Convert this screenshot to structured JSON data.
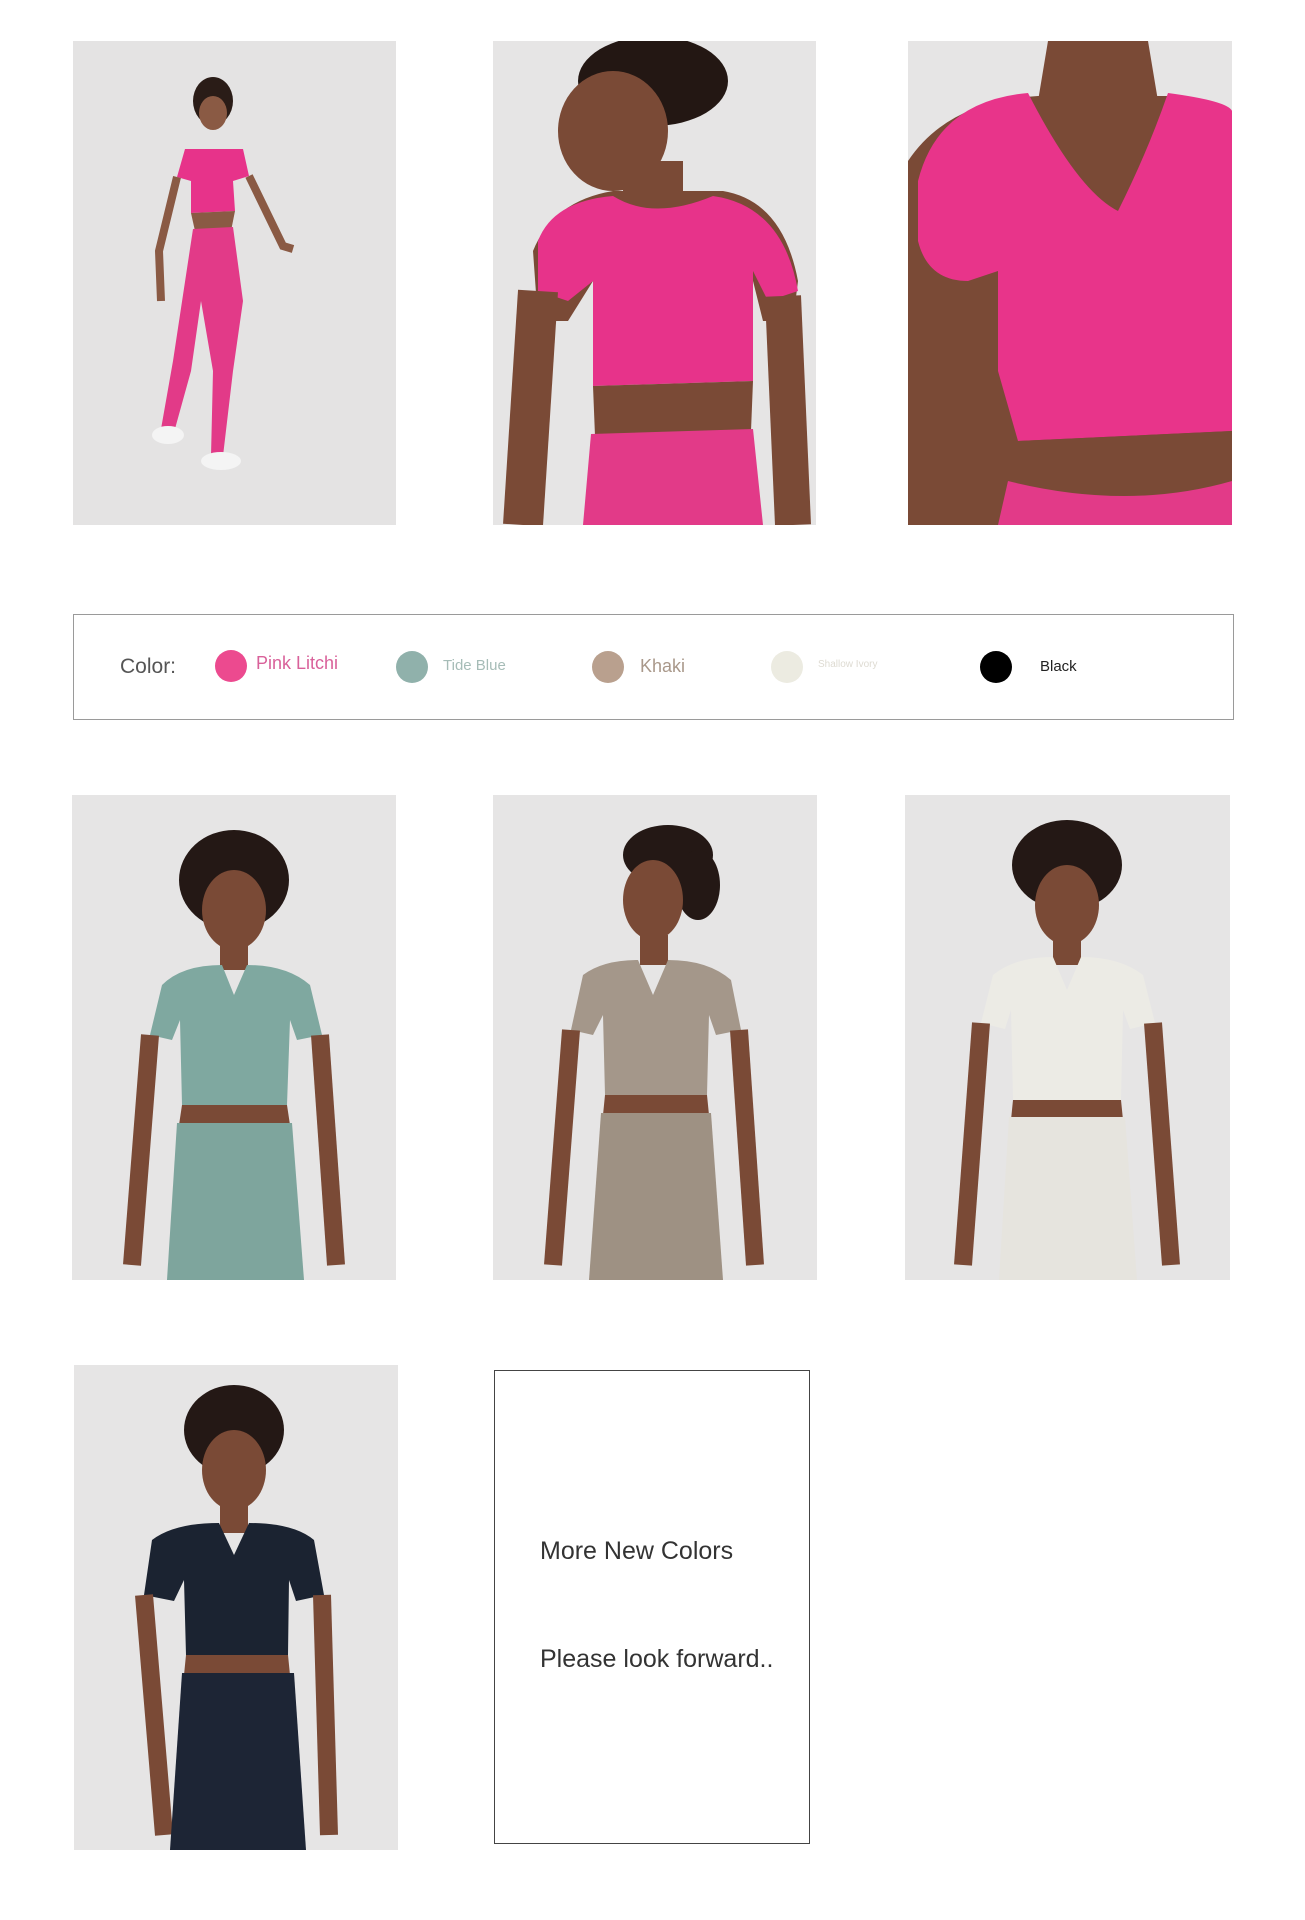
{
  "photos": {
    "pink_full_body": {
      "icon": "model-photo-full-body",
      "shirt_color": "#e7338a",
      "pants_color": "#e23a88"
    },
    "pink_back_view": {
      "icon": "model-photo-back-view",
      "shirt_color": "#e7338a",
      "pants_color": "#e23a88"
    },
    "pink_closeup": {
      "icon": "model-photo-closeup",
      "shirt_color": "#e8348a",
      "pants_color": "#e23a88"
    },
    "tide_blue": {
      "icon": "model-photo-front",
      "shirt_color": "#7fa8a0",
      "pants_color": "#7ea59d"
    },
    "khaki": {
      "icon": "model-photo-front",
      "shirt_color": "#a4978a",
      "pants_color": "#9e9183"
    },
    "shallow_ivory": {
      "icon": "model-photo-front",
      "shirt_color": "#ecebe5",
      "pants_color": "#e6e4de"
    },
    "black": {
      "icon": "model-photo-front",
      "shirt_color": "#1b2331",
      "pants_color": "#1d2535"
    }
  },
  "colors": {
    "label": "Color:",
    "options": [
      {
        "name": "Pink Litchi",
        "hex": "#ec4a8f",
        "text_color": "#d9619a"
      },
      {
        "name": "Tide Blue",
        "hex": "#90b1ab",
        "text_color": "#a6bcb7"
      },
      {
        "name": "Khaki",
        "hex": "#b9a08e",
        "text_color": "#a9988a"
      },
      {
        "name": "Shallow Ivory",
        "hex": "#ecebe1",
        "text_color": "#dedbd2"
      },
      {
        "name": "Black",
        "hex": "#000000",
        "text_color": "#222222"
      }
    ]
  },
  "coming_soon": {
    "line1": "More New Colors",
    "line2": "Please look forward.."
  }
}
